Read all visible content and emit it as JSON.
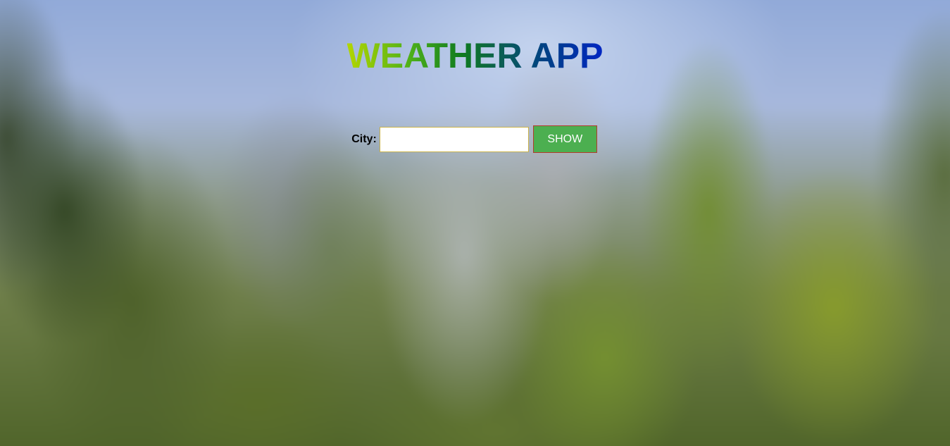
{
  "header": {
    "title": "WEATHER APP"
  },
  "search": {
    "city_label": "City:",
    "city_value": "",
    "city_placeholder": "",
    "show_label": "SHOW"
  },
  "colors": {
    "title_gradient_start": "#b3d600",
    "title_gradient_end": "#0026c2",
    "button_background": "#4caf50",
    "button_border": "#b23b2b"
  }
}
